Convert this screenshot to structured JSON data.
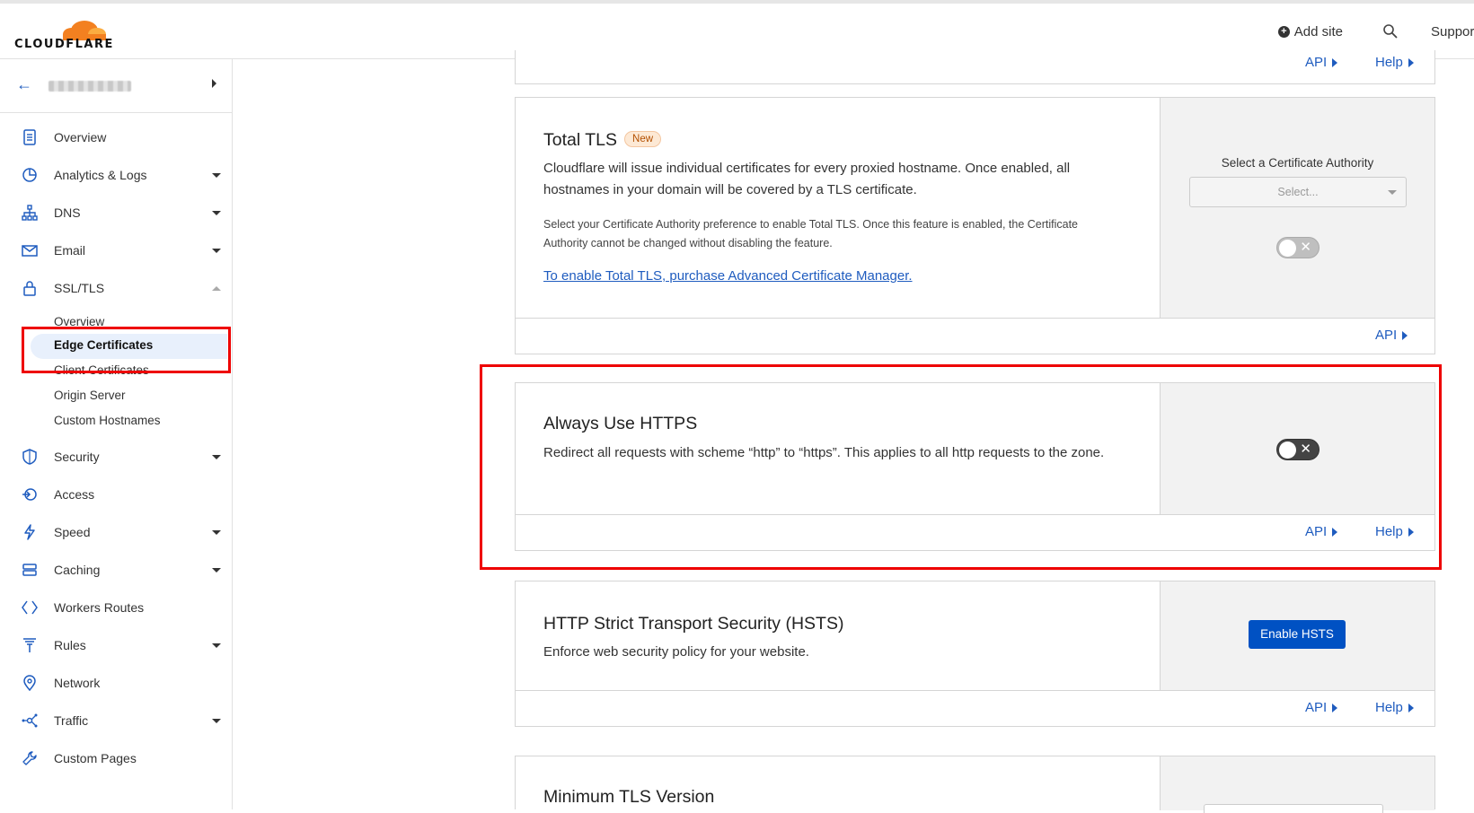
{
  "header": {
    "logo_text": "CLOUDFLARE",
    "add_site": "Add site",
    "support": "Support"
  },
  "sidebar": {
    "items": [
      {
        "label": "Overview",
        "icon": "document-icon"
      },
      {
        "label": "Analytics & Logs",
        "icon": "pie-chart-icon"
      },
      {
        "label": "DNS",
        "icon": "network-tree-icon"
      },
      {
        "label": "Email",
        "icon": "envelope-icon"
      },
      {
        "label": "SSL/TLS",
        "icon": "lock-icon"
      },
      {
        "label": "Security",
        "icon": "shield-icon"
      },
      {
        "label": "Access",
        "icon": "access-icon"
      },
      {
        "label": "Speed",
        "icon": "lightning-icon"
      },
      {
        "label": "Caching",
        "icon": "server-stack-icon"
      },
      {
        "label": "Workers Routes",
        "icon": "workers-icon"
      },
      {
        "label": "Rules",
        "icon": "funnel-icon"
      },
      {
        "label": "Network",
        "icon": "location-pin-icon"
      },
      {
        "label": "Traffic",
        "icon": "traffic-icon"
      },
      {
        "label": "Custom Pages",
        "icon": "wrench-icon"
      }
    ],
    "ssl_sub": [
      {
        "label": "Overview"
      },
      {
        "label": "Edge Certificates",
        "active": true
      },
      {
        "label": "Client Certificates"
      },
      {
        "label": "Origin Server"
      },
      {
        "label": "Custom Hostnames"
      }
    ]
  },
  "cards": {
    "prev_footer": {
      "api": "API",
      "help": "Help"
    },
    "total_tls": {
      "title": "Total TLS",
      "badge": "New",
      "desc": "Cloudflare will issue individual certificates for every proxied hostname. Once enabled, all hostnames in your domain will be covered by a TLS certificate.",
      "note": "Select your Certificate Authority preference to enable Total TLS. Once this feature is enabled, the Certificate Authority cannot be changed without disabling the feature.",
      "link": "To enable Total TLS, purchase Advanced Certificate Manager.",
      "side_label": "Select a Certificate Authority",
      "select_placeholder": "Select...",
      "api": "API"
    },
    "always_https": {
      "title": "Always Use HTTPS",
      "desc": "Redirect all requests with scheme “http” to “https”. This applies to all http requests to the zone.",
      "api": "API",
      "help": "Help"
    },
    "hsts": {
      "title": "HTTP Strict Transport Security (HSTS)",
      "desc": "Enforce web security policy for your website.",
      "button": "Enable HSTS",
      "api": "API",
      "help": "Help"
    },
    "min_tls": {
      "title": "Minimum TLS Version"
    }
  },
  "colors": {
    "brand_orange": "#f38020",
    "link_blue": "#1f5cbf",
    "primary_button": "#0051c3",
    "highlight_red": "#e00000"
  }
}
